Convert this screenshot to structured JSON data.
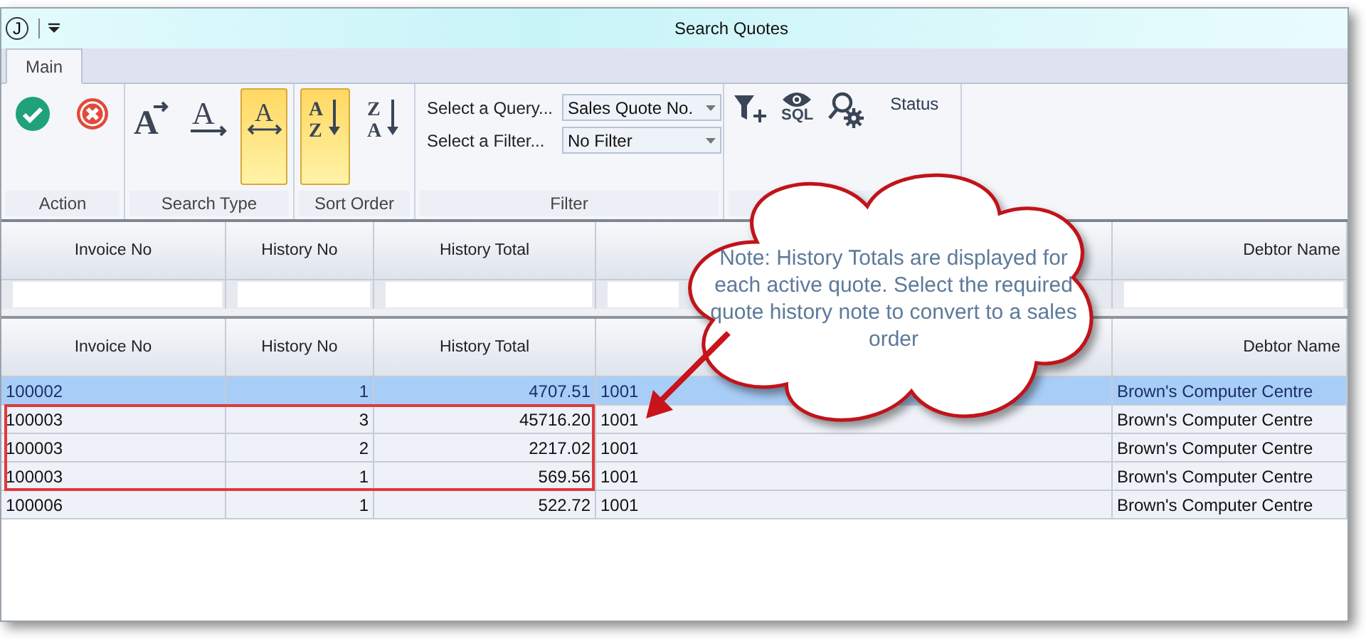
{
  "window": {
    "title": "Search Quotes",
    "logo": "J"
  },
  "tabs": [
    {
      "label": "Main",
      "selected": true
    }
  ],
  "ribbon": {
    "groups": [
      {
        "kind": "action",
        "label": "Action",
        "buttons": [
          {
            "kind": "ok",
            "selected": false
          },
          {
            "kind": "cancel",
            "selected": false
          }
        ]
      },
      {
        "kind": "search_type",
        "label": "Search Type",
        "buttons": [
          {
            "kind": "starts",
            "glyph": "A",
            "selected": false
          },
          {
            "kind": "underline",
            "glyph": "A",
            "selected": false
          },
          {
            "kind": "contains",
            "glyph": "A",
            "selected": true
          }
        ]
      },
      {
        "kind": "sort_order",
        "label": "Sort Order",
        "buttons": [
          {
            "kind": "ascending",
            "glyphs": [
              "A",
              "Z"
            ],
            "selected": true
          },
          {
            "kind": "descending",
            "glyphs": [
              "Z",
              "A"
            ],
            "selected": false
          }
        ]
      },
      {
        "kind": "filter",
        "label": "Filter",
        "query_label": "Select a Query...",
        "query_value": "Sales Quote No.",
        "filter_label": "Select a Filter...",
        "filter_value": "No Filter"
      },
      {
        "kind": "tools",
        "sql": "SQL",
        "status": "Status"
      }
    ]
  },
  "filter_grid": {
    "columns": [
      {
        "label": "Invoice No"
      },
      {
        "label": "History No"
      },
      {
        "label": "History Total"
      },
      {},
      {
        "label": "Debtor Name"
      }
    ]
  },
  "table": {
    "columns": [
      {
        "label": "Invoice No"
      },
      {
        "label": "History No"
      },
      {
        "label": "History Total"
      },
      {},
      {
        "label": "Debtor Name"
      }
    ],
    "rows": [
      {
        "invoice": "100002",
        "history_no": "1",
        "total": "4707.51",
        "column_4": "1001",
        "debtor": "Brown's Computer Centre",
        "selected": true,
        "boxed": false
      },
      {
        "invoice": "100003",
        "history_no": "3",
        "total": "45716.20",
        "column_4": "1001",
        "debtor": "Brown's Computer Centre",
        "selected": false,
        "boxed": true
      },
      {
        "invoice": "100003",
        "history_no": "2",
        "total": "2217.02",
        "column_4": "1001",
        "debtor": "Brown's Computer Centre",
        "selected": false,
        "boxed": true
      },
      {
        "invoice": "100003",
        "history_no": "1",
        "total": "569.56",
        "column_4": "1001",
        "debtor": "Brown's Computer Centre",
        "selected": false,
        "boxed": true
      },
      {
        "invoice": "100006",
        "history_no": "1",
        "total": "522.72",
        "column_4": "1001",
        "debtor": "Brown's Computer Centre",
        "selected": false,
        "boxed": false
      }
    ]
  },
  "callout": {
    "text": "Note: History Totals are displayed for each active quote.  Select the required quote history note to convert to a sales order"
  }
}
